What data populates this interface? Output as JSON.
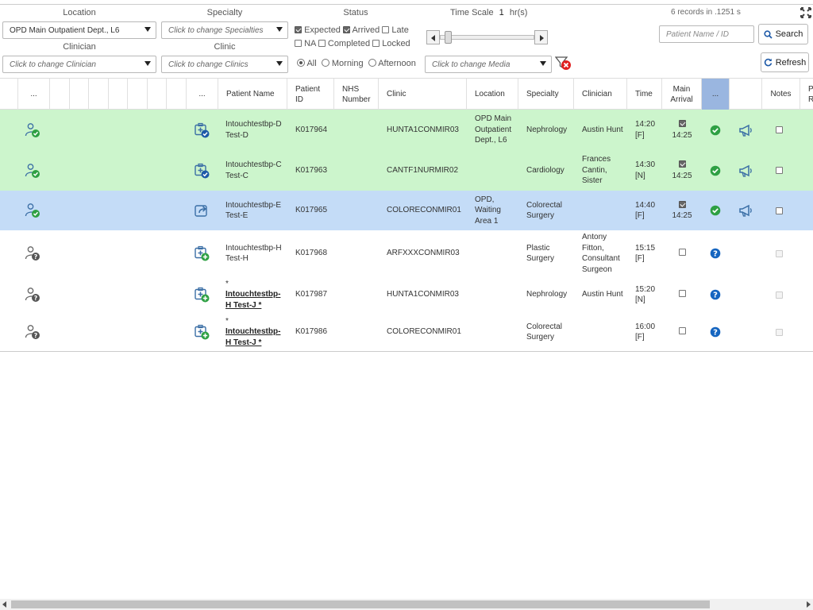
{
  "filters": {
    "location_label": "Location",
    "location_value": "OPD Main Outpatient Dept., L6",
    "specialty_label": "Specialty",
    "specialty_placeholder": "Click to change Specialties",
    "status_label": "Status",
    "status_options": [
      {
        "label": "Expected",
        "checked": true
      },
      {
        "label": "Arrived",
        "checked": true
      },
      {
        "label": "Late",
        "checked": false
      },
      {
        "label": "NA",
        "checked": false
      },
      {
        "label": "Completed",
        "checked": false
      },
      {
        "label": "Locked",
        "checked": false
      }
    ],
    "clinician_label": "Clinician",
    "clinician_placeholder": "Click to change Clinician",
    "clinic_label": "Clinic",
    "clinic_placeholder": "Click to change Clinics",
    "session_options": [
      "All",
      "Morning",
      "Afternoon"
    ],
    "session_selected": "All",
    "media_placeholder": "Click to change Media",
    "time_scale_label": "Time Scale",
    "time_scale_value": "1",
    "time_scale_unit": "hr(s)",
    "time_scale_fraction": 0.05
  },
  "records_info": "6 records in .1251 s",
  "search": {
    "placeholder": "Patient Name / ID",
    "button": "Search"
  },
  "refresh_button": "Refresh",
  "columns": {
    "dots1": "...",
    "dots2": "...",
    "patient_name": "Patient Name",
    "patient_id": "Patient ID",
    "nhs": "NHS Number",
    "clinic": "Clinic",
    "location": "Location",
    "specialty": "Specialty",
    "clinician": "Clinician",
    "time": "Time",
    "main_arrival": "Main Arrival",
    "dots3": "...",
    "notes": "Notes",
    "partial": "P R"
  },
  "rows": [
    {
      "name": "Intouchtestbp-D Test-D",
      "id": "K017964",
      "clinic": "HUNTA1CONMIR03",
      "location": "OPD Main Outpatient Dept., L6",
      "specialty": "Nephrology",
      "clinician": "Austin Hunt",
      "time": "14:20 [F]",
      "arrival_checked": true,
      "arrival_time": "14:25",
      "status": "arrived",
      "bg": "green",
      "link": false,
      "person": "ok",
      "appt": "ok"
    },
    {
      "name": "Intouchtestbp-C Test-C",
      "id": "K017963",
      "clinic": "CANTF1NURMIR02",
      "location": "",
      "specialty": "Cardiology",
      "clinician": "Frances Cantin, Sister",
      "time": "14:30 [N]",
      "arrival_checked": true,
      "arrival_time": "14:25",
      "status": "arrived",
      "bg": "green",
      "link": false,
      "person": "ok",
      "appt": "ok"
    },
    {
      "name": "Intouchtestbp-E Test-E",
      "id": "K017965",
      "clinic": "COLORECONMIR01",
      "location": "OPD, Waiting Area 1",
      "specialty": "Colorectal Surgery",
      "clinician": "",
      "time": "14:40 [F]",
      "arrival_checked": true,
      "arrival_time": "14:25",
      "status": "arrived",
      "bg": "blue",
      "link": false,
      "person": "ok",
      "appt": "share"
    },
    {
      "name": "Intouchtestbp-H Test-H",
      "id": "K017968",
      "clinic": "ARFXXXCONMIR03",
      "location": "",
      "specialty": "Plastic Surgery",
      "clinician": "Antony Fitton, Consultant Surgeon",
      "time": "15:15 [F]",
      "arrival_checked": false,
      "arrival_time": "",
      "status": "unknown",
      "bg": "white",
      "link": false,
      "person": "q",
      "appt": "add"
    },
    {
      "name": "Intouchtestbp-H Test-J *",
      "prefix": "*",
      "id": "K017987",
      "clinic": "HUNTA1CONMIR03",
      "location": "",
      "specialty": "Nephrology",
      "clinician": "Austin Hunt",
      "time": "15:20 [N]",
      "arrival_checked": false,
      "arrival_time": "",
      "status": "unknown",
      "bg": "white",
      "link": true,
      "person": "q",
      "appt": "add"
    },
    {
      "name": "Intouchtestbp-H Test-J *",
      "prefix": "*",
      "id": "K017986",
      "clinic": "COLORECONMIR01",
      "location": "",
      "specialty": "Colorectal Surgery",
      "clinician": "",
      "time": "16:00 [F]",
      "arrival_checked": false,
      "arrival_time": "",
      "status": "unknown",
      "bg": "white",
      "link": true,
      "person": "q",
      "appt": "add"
    }
  ],
  "colors": {
    "green_row": "#ccf5cc",
    "blue_row": "#c4dcf7",
    "selected_col": "#9ab6e0",
    "ok_green": "#2ea043",
    "help_blue": "#1565c0",
    "icon_blue": "#3a6ea5"
  }
}
